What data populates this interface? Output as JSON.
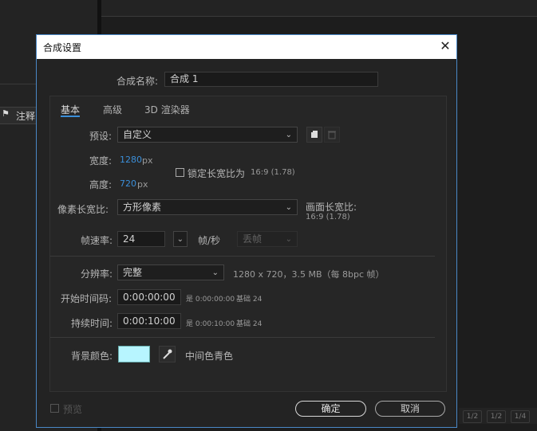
{
  "background": {
    "tag_label": "注释",
    "tag_icon": "tag-icon",
    "bottom_buttons": [
      "1/2",
      "1/2",
      "1/4"
    ]
  },
  "dialog": {
    "title": "合成设置",
    "close_icon": "close-icon",
    "name_label": "合成名称:",
    "name_value": "合成 1",
    "tabs": [
      {
        "label": "基本",
        "active": true
      },
      {
        "label": "高级",
        "active": false
      },
      {
        "label": "3D 渲染器",
        "active": false
      }
    ],
    "preset_label": "预设:",
    "preset_value": "自定义",
    "width_label": "宽度:",
    "width_value": "1280",
    "width_unit": "px",
    "height_label": "高度:",
    "height_value": "720",
    "height_unit": "px",
    "lock_label": "锁定长宽比为",
    "lock_ratio": "16:9 (1.78)",
    "pixel_aspect_label": "像素长宽比:",
    "pixel_aspect_value": "方形像素",
    "frame_aspect_label": "画面长宽比:",
    "frame_aspect_value": "16:9 (1.78)",
    "framerate_label": "帧速率:",
    "framerate_value": "24",
    "framerate_unit": "帧/秒",
    "dropframe_value": "丢帧",
    "resolution_label": "分辨率:",
    "resolution_value": "完整",
    "resolution_info": "1280 x 720，3.5 MB（每 8bpc 帧）",
    "start_tc_label": "开始时间码:",
    "start_tc_value": "0:00:00:00",
    "start_tc_info": "是 0:00:00:00",
    "start_tc_base": "基础 24",
    "duration_label": "持续时间:",
    "duration_value": "0:00:10:00",
    "duration_info": "是 0:00:10:00",
    "duration_base": "基础 24",
    "bg_color_label": "背景颜色:",
    "bg_color_hex": "#b7f5ff",
    "bg_color_name": "中间色青色",
    "preview_label": "预览",
    "ok_label": "确定",
    "cancel_label": "取消"
  }
}
